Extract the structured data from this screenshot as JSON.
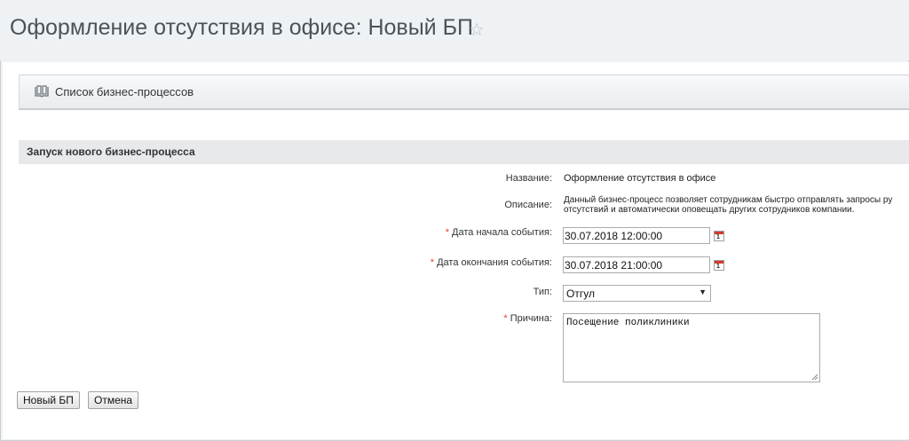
{
  "header": {
    "title": "Оформление отсутствия в офисе: Новый БП"
  },
  "toolbar": {
    "bp_list_label": "Список бизнес-процессов"
  },
  "form": {
    "section_title": "Запуск нового бизнес-процесса",
    "name_label": "Название:",
    "name_value": "Оформление отсутствия в офисе",
    "description_label": "Описание:",
    "description_line1": "Данный бизнес-процесс позволяет сотрудникам быстро отправлять запросы ру",
    "description_line2": "отсутствий и автоматически оповещать других сотрудников компании.",
    "required_mark": "*",
    "start_label": "Дата начала события:",
    "start_value": "30.07.2018 12:00:00",
    "end_label": "Дата окончания события:",
    "end_value": "30.07.2018 21:00:00",
    "type_label": "Тип:",
    "type_value": "Отгул",
    "reason_label": "Причина:",
    "reason_value": "Посещение поликлиники",
    "calendar_day": "1"
  },
  "buttons": {
    "new_bp": "Новый БП",
    "cancel": "Отмена"
  },
  "icons": {
    "favorite": "star-icon",
    "list": "book-icon",
    "calendar": "calendar-icon",
    "dropdown": "chevron-down-icon"
  },
  "colors": {
    "required": "#e0432f",
    "calendar_accent": "#d43a2a"
  }
}
